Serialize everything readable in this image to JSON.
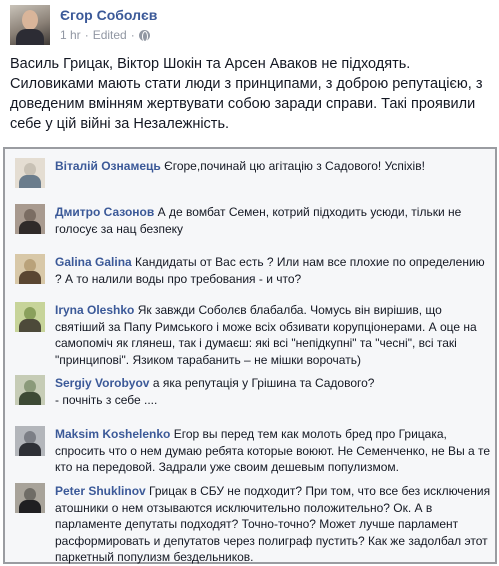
{
  "post": {
    "author": "Єгор Соболєв",
    "time": "1 hr",
    "separator1": "·",
    "edited": "Edited",
    "separator2": "·",
    "text": "Василь Грицак, Віктор Шокін та Арсен Аваков не підходять. Силовиками мають стати люди з принципами, з доброю репутацією, з доведеним вмінням жертвувати собою заради справи. Такі проявили себе у цій війні за Незалежність.",
    "avatar_icon": "user-photo",
    "privacy_icon": "globe-icon"
  },
  "comments": [
    {
      "name": "Віталій Ознамець",
      "text": "Єгоре,починай цю агітацію з Садового! Успіхів!",
      "avatar_colors": [
        "#c8c1b5",
        "#6a7c8c",
        "#e4ddd2"
      ]
    },
    {
      "name": "Дмитро Сазонов",
      "text": "А де вомбат Семен, котрий підходить усюди, тільки не голосує за нац безпеку",
      "avatar_colors": [
        "#7b6d63",
        "#2f2a29",
        "#a89a8f"
      ]
    },
    {
      "name": "Galina Galina",
      "text": "Кандидаты от Вас есть ? Или нам все плохие по определению ? А то налили воды про требования - и что?",
      "avatar_colors": [
        "#b9a27a",
        "#5a4632",
        "#d8c8a8"
      ]
    },
    {
      "name": "Iryna Oleshko",
      "text": "Як завжди Соболєв блабалба. Чомусь він вирішив, що святіший за Папу Римського і може всіх обзивати корупціонерами. А оце на самопоміч як глянеш, так і думаєш: які всі \"непідкупні\" та \"чесні\", всі такі \"принципові\". Язиком тарабанить – не мішки ворочать)",
      "avatar_colors": [
        "#8aa05c",
        "#4d4a3a",
        "#c7d49a"
      ]
    },
    {
      "name": "Sergiy Vorobyov",
      "text": "а яка репутація у Грішина та Садового?",
      "text2": "- почніть з себе ....",
      "avatar_colors": [
        "#8b9a7a",
        "#3d4a35",
        "#c6ccb6"
      ]
    },
    {
      "name": "Maksim Koshelenko",
      "text": "Егор вы перед тем как молоть бред про Грицака, спросить что о нем думаю ребята которые воюют. Не Семенченко, не Вы а те кто на передовой. Задрали уже своим дешевым популизмом.",
      "avatar_colors": [
        "#7c7f86",
        "#2e3036",
        "#b3b6bb"
      ]
    },
    {
      "name": "Peter Shuklinov",
      "text": "Грицак в СБУ не подходит? При том, что все без исключения атошники о нем отзываются исключительно положительно? Ок. А в парламенте депутаты подходят? Точно-точно? Может лучше парламент расформировать и депутатов через полиграф пустить? Как же задолбал этот паркетный популизм бездельников.",
      "avatar_colors": [
        "#6f6c66",
        "#1f1f22",
        "#a8a39a"
      ]
    }
  ]
}
